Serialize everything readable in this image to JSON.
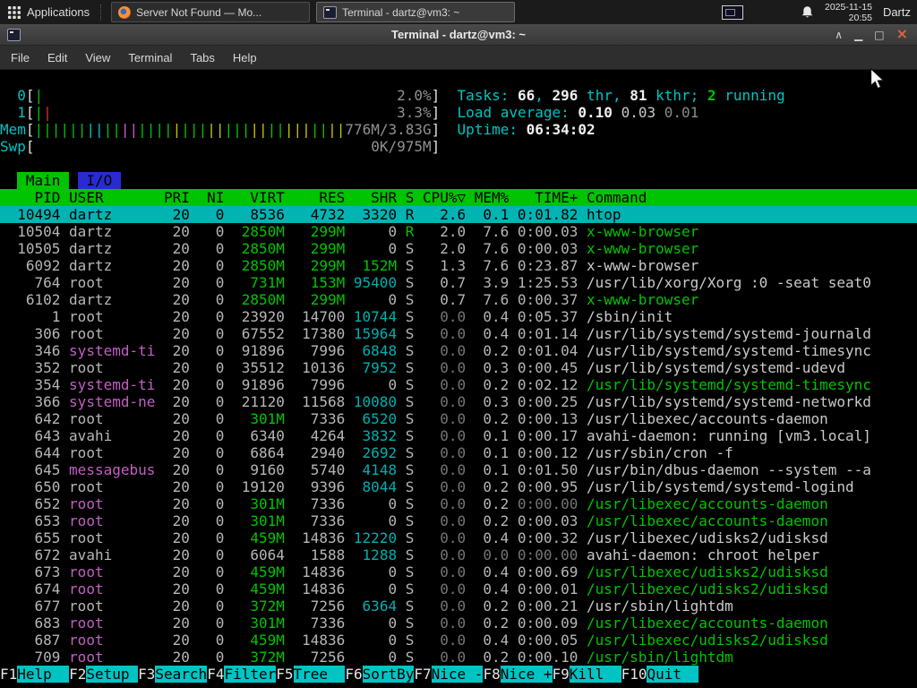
{
  "panel": {
    "applications_label": "Applications",
    "taskbar": [
      {
        "title": "Server Not Found — Mo...",
        "icon": "firefox-icon",
        "active": false
      },
      {
        "title": "Terminal - dartz@vm3: ~",
        "icon": "terminal-icon",
        "active": true
      }
    ],
    "clock": {
      "date": "2025-11-15",
      "time": "20:55"
    },
    "user_label": "Dartz"
  },
  "window": {
    "title": "Terminal - dartz@vm3: ~",
    "menu": [
      "File",
      "Edit",
      "View",
      "Terminal",
      "Tabs",
      "Help"
    ],
    "controls": {
      "shade": "∧",
      "minimize": "▁",
      "maximize": "□",
      "close": "×"
    }
  },
  "htop": {
    "colors": {
      "green": "#00c400",
      "cyan": "#00c4c4",
      "magenta": "#c35fc3",
      "yellow": "#c4c400",
      "red": "#d02f2f",
      "selected_bg": "#00b4b4",
      "header_bg": "#00c400"
    },
    "meters": {
      "bracket_open": "[",
      "bracket_close": "]",
      "cpu0": {
        "label": "0",
        "text": "2.0%",
        "ticks": [
          {
            "color": "g",
            "n": 1
          }
        ]
      },
      "cpu1": {
        "label": "1",
        "text": "3.3%",
        "ticks": [
          {
            "color": "g",
            "n": 1
          },
          {
            "color": "r",
            "n": 1
          }
        ]
      },
      "mem": {
        "label": "Mem",
        "text": "776M/3.83G",
        "ticks": [
          {
            "color": "g",
            "n": 6
          },
          {
            "color": "c",
            "n": 2
          },
          {
            "color": "g",
            "n": 2
          },
          {
            "color": "m",
            "n": 2
          },
          {
            "color": "g",
            "n": 4
          },
          {
            "color": "y",
            "n": 1
          },
          {
            "color": "g",
            "n": 3
          },
          {
            "color": "y",
            "n": 2
          },
          {
            "color": "g",
            "n": 3
          },
          {
            "color": "y",
            "n": 2
          },
          {
            "color": "g",
            "n": 2
          },
          {
            "color": "y",
            "n": 3
          },
          {
            "color": "g",
            "n": 2
          },
          {
            "color": "y",
            "n": 2
          }
        ]
      },
      "swp": {
        "label": "Swp",
        "text": "0K/975M",
        "ticks": []
      }
    },
    "stats": {
      "tasks": {
        "label": "Tasks: ",
        "count": "66",
        "sep": ", ",
        "thr": "296",
        "thr_label": " thr, ",
        "kthr": "81",
        "kthr_label": " kthr; ",
        "running": "2",
        "running_label": " running"
      },
      "load": {
        "label": "Load average: ",
        "one": "0.10",
        "s1": " ",
        "five": "0.03",
        "s2": " ",
        "fifteen": "0.01"
      },
      "uptime": {
        "label": "Uptime: ",
        "value": "06:34:02"
      }
    },
    "tabs": [
      {
        "label": "Main",
        "active": true
      },
      {
        "label": "I/O",
        "active": false
      }
    ],
    "columns": [
      "PID",
      "USER",
      "PRI",
      "NI",
      "VIRT",
      "RES",
      "SHR",
      "S",
      "CPU%▽",
      "MEM%",
      "TIME+",
      "Command"
    ],
    "processes": [
      {
        "pid": "10494",
        "user": "dartz",
        "pri": "20",
        "ni": "0",
        "virt": "8536",
        "res": "4732",
        "shr": "3320",
        "s": "R",
        "cpu": "2.6",
        "mem": "0.1",
        "time": "0:01.82",
        "cmd": "htop",
        "sel": true,
        "thr": false,
        "ualt": false
      },
      {
        "pid": "10504",
        "user": "dartz",
        "pri": "20",
        "ni": "0",
        "virt": "2850M",
        "res": "299M",
        "shr": "0",
        "s": "R",
        "cpu": "2.0",
        "mem": "7.6",
        "time": "0:00.03",
        "cmd": "x-www-browser",
        "sel": false,
        "thr": true,
        "ualt": false
      },
      {
        "pid": "10505",
        "user": "dartz",
        "pri": "20",
        "ni": "0",
        "virt": "2850M",
        "res": "299M",
        "shr": "0",
        "s": "S",
        "cpu": "2.0",
        "mem": "7.6",
        "time": "0:00.03",
        "cmd": "x-www-browser",
        "sel": false,
        "thr": true,
        "ualt": false
      },
      {
        "pid": "6092",
        "user": "dartz",
        "pri": "20",
        "ni": "0",
        "virt": "2850M",
        "res": "299M",
        "shr": "152M",
        "s": "S",
        "cpu": "1.3",
        "mem": "7.6",
        "time": "0:23.87",
        "cmd": "x-www-browser",
        "sel": false,
        "thr": false,
        "ualt": false
      },
      {
        "pid": "764",
        "user": "root",
        "pri": "20",
        "ni": "0",
        "virt": "731M",
        "res": "153M",
        "shr": "95400",
        "s": "S",
        "cpu": "0.7",
        "mem": "3.9",
        "time": "1:25.53",
        "cmd": "/usr/lib/xorg/Xorg :0 -seat seat0",
        "sel": false,
        "thr": false,
        "ualt": false
      },
      {
        "pid": "6102",
        "user": "dartz",
        "pri": "20",
        "ni": "0",
        "virt": "2850M",
        "res": "299M",
        "shr": "0",
        "s": "S",
        "cpu": "0.7",
        "mem": "7.6",
        "time": "0:00.37",
        "cmd": "x-www-browser",
        "sel": false,
        "thr": true,
        "ualt": false
      },
      {
        "pid": "1",
        "user": "root",
        "pri": "20",
        "ni": "0",
        "virt": "23920",
        "res": "14700",
        "shr": "10744",
        "s": "S",
        "cpu": "0.0",
        "mem": "0.4",
        "time": "0:05.37",
        "cmd": "/sbin/init",
        "sel": false,
        "thr": false,
        "ualt": false
      },
      {
        "pid": "306",
        "user": "root",
        "pri": "20",
        "ni": "0",
        "virt": "67552",
        "res": "17380",
        "shr": "15964",
        "s": "S",
        "cpu": "0.0",
        "mem": "0.4",
        "time": "0:01.14",
        "cmd": "/usr/lib/systemd/systemd-journald",
        "sel": false,
        "thr": false,
        "ualt": false
      },
      {
        "pid": "346",
        "user": "systemd-ti",
        "pri": "20",
        "ni": "0",
        "virt": "91896",
        "res": "7996",
        "shr": "6848",
        "s": "S",
        "cpu": "0.0",
        "mem": "0.2",
        "time": "0:01.04",
        "cmd": "/usr/lib/systemd/systemd-timesync",
        "sel": false,
        "thr": false,
        "ualt": true
      },
      {
        "pid": "352",
        "user": "root",
        "pri": "20",
        "ni": "0",
        "virt": "35512",
        "res": "10136",
        "shr": "7952",
        "s": "S",
        "cpu": "0.0",
        "mem": "0.3",
        "time": "0:00.45",
        "cmd": "/usr/lib/systemd/systemd-udevd",
        "sel": false,
        "thr": false,
        "ualt": false
      },
      {
        "pid": "354",
        "user": "systemd-ti",
        "pri": "20",
        "ni": "0",
        "virt": "91896",
        "res": "7996",
        "shr": "0",
        "s": "S",
        "cpu": "0.0",
        "mem": "0.2",
        "time": "0:02.12",
        "cmd": "/usr/lib/systemd/systemd-timesync",
        "sel": false,
        "thr": true,
        "ualt": true
      },
      {
        "pid": "366",
        "user": "systemd-ne",
        "pri": "20",
        "ni": "0",
        "virt": "21120",
        "res": "11568",
        "shr": "10080",
        "s": "S",
        "cpu": "0.0",
        "mem": "0.3",
        "time": "0:00.25",
        "cmd": "/usr/lib/systemd/systemd-networkd",
        "sel": false,
        "thr": false,
        "ualt": true
      },
      {
        "pid": "642",
        "user": "root",
        "pri": "20",
        "ni": "0",
        "virt": "301M",
        "res": "7336",
        "shr": "6520",
        "s": "S",
        "cpu": "0.0",
        "mem": "0.2",
        "time": "0:00.13",
        "cmd": "/usr/libexec/accounts-daemon",
        "sel": false,
        "thr": false,
        "ualt": false
      },
      {
        "pid": "643",
        "user": "avahi",
        "pri": "20",
        "ni": "0",
        "virt": "6340",
        "res": "4264",
        "shr": "3832",
        "s": "S",
        "cpu": "0.0",
        "mem": "0.1",
        "time": "0:00.17",
        "cmd": "avahi-daemon: running [vm3.local]",
        "sel": false,
        "thr": false,
        "ualt": false
      },
      {
        "pid": "644",
        "user": "root",
        "pri": "20",
        "ni": "0",
        "virt": "6864",
        "res": "2940",
        "shr": "2692",
        "s": "S",
        "cpu": "0.0",
        "mem": "0.1",
        "time": "0:00.12",
        "cmd": "/usr/sbin/cron -f",
        "sel": false,
        "thr": false,
        "ualt": false
      },
      {
        "pid": "645",
        "user": "messagebus",
        "pri": "20",
        "ni": "0",
        "virt": "9160",
        "res": "5740",
        "shr": "4148",
        "s": "S",
        "cpu": "0.0",
        "mem": "0.1",
        "time": "0:01.50",
        "cmd": "/usr/bin/dbus-daemon --system --a",
        "sel": false,
        "thr": false,
        "ualt": true
      },
      {
        "pid": "650",
        "user": "root",
        "pri": "20",
        "ni": "0",
        "virt": "19120",
        "res": "9396",
        "shr": "8044",
        "s": "S",
        "cpu": "0.0",
        "mem": "0.2",
        "time": "0:00.95",
        "cmd": "/usr/lib/systemd/systemd-logind",
        "sel": false,
        "thr": false,
        "ualt": false
      },
      {
        "pid": "652",
        "user": "root",
        "pri": "20",
        "ni": "0",
        "virt": "301M",
        "res": "7336",
        "shr": "0",
        "s": "S",
        "cpu": "0.0",
        "mem": "0.2",
        "time": "0:00.00",
        "cmd": "/usr/libexec/accounts-daemon",
        "sel": false,
        "thr": true,
        "ualt": true
      },
      {
        "pid": "653",
        "user": "root",
        "pri": "20",
        "ni": "0",
        "virt": "301M",
        "res": "7336",
        "shr": "0",
        "s": "S",
        "cpu": "0.0",
        "mem": "0.2",
        "time": "0:00.03",
        "cmd": "/usr/libexec/accounts-daemon",
        "sel": false,
        "thr": true,
        "ualt": true
      },
      {
        "pid": "655",
        "user": "root",
        "pri": "20",
        "ni": "0",
        "virt": "459M",
        "res": "14836",
        "shr": "12220",
        "s": "S",
        "cpu": "0.0",
        "mem": "0.4",
        "time": "0:00.32",
        "cmd": "/usr/libexec/udisks2/udisksd",
        "sel": false,
        "thr": false,
        "ualt": false
      },
      {
        "pid": "672",
        "user": "avahi",
        "pri": "20",
        "ni": "0",
        "virt": "6064",
        "res": "1588",
        "shr": "1288",
        "s": "S",
        "cpu": "0.0",
        "mem": "0.0",
        "time": "0:00.00",
        "cmd": "avahi-daemon: chroot helper",
        "sel": false,
        "thr": false,
        "ualt": false
      },
      {
        "pid": "673",
        "user": "root",
        "pri": "20",
        "ni": "0",
        "virt": "459M",
        "res": "14836",
        "shr": "0",
        "s": "S",
        "cpu": "0.0",
        "mem": "0.4",
        "time": "0:00.69",
        "cmd": "/usr/libexec/udisks2/udisksd",
        "sel": false,
        "thr": true,
        "ualt": true
      },
      {
        "pid": "674",
        "user": "root",
        "pri": "20",
        "ni": "0",
        "virt": "459M",
        "res": "14836",
        "shr": "0",
        "s": "S",
        "cpu": "0.0",
        "mem": "0.4",
        "time": "0:00.01",
        "cmd": "/usr/libexec/udisks2/udisksd",
        "sel": false,
        "thr": true,
        "ualt": true
      },
      {
        "pid": "677",
        "user": "root",
        "pri": "20",
        "ni": "0",
        "virt": "372M",
        "res": "7256",
        "shr": "6364",
        "s": "S",
        "cpu": "0.0",
        "mem": "0.2",
        "time": "0:00.21",
        "cmd": "/usr/sbin/lightdm",
        "sel": false,
        "thr": false,
        "ualt": false
      },
      {
        "pid": "683",
        "user": "root",
        "pri": "20",
        "ni": "0",
        "virt": "301M",
        "res": "7336",
        "shr": "0",
        "s": "S",
        "cpu": "0.0",
        "mem": "0.2",
        "time": "0:00.09",
        "cmd": "/usr/libexec/accounts-daemon",
        "sel": false,
        "thr": true,
        "ualt": true
      },
      {
        "pid": "687",
        "user": "root",
        "pri": "20",
        "ni": "0",
        "virt": "459M",
        "res": "14836",
        "shr": "0",
        "s": "S",
        "cpu": "0.0",
        "mem": "0.4",
        "time": "0:00.05",
        "cmd": "/usr/libexec/udisks2/udisksd",
        "sel": false,
        "thr": true,
        "ualt": true
      },
      {
        "pid": "709",
        "user": "root",
        "pri": "20",
        "ni": "0",
        "virt": "372M",
        "res": "7256",
        "shr": "0",
        "s": "S",
        "cpu": "0.0",
        "mem": "0.2",
        "time": "0:00.10",
        "cmd": "/usr/sbin/lightdm",
        "sel": false,
        "thr": true,
        "ualt": true
      }
    ]
  },
  "fnbar": [
    {
      "key": "F1",
      "label": "Help"
    },
    {
      "key": "F2",
      "label": "Setup"
    },
    {
      "key": "F3",
      "label": "Search"
    },
    {
      "key": "F4",
      "label": "Filter"
    },
    {
      "key": "F5",
      "label": "Tree"
    },
    {
      "key": "F6",
      "label": "SortBy"
    },
    {
      "key": "F7",
      "label": "Nice -"
    },
    {
      "key": "F8",
      "label": "Nice +"
    },
    {
      "key": "F9",
      "label": "Kill"
    },
    {
      "key": "F10",
      "label": "Quit"
    }
  ]
}
